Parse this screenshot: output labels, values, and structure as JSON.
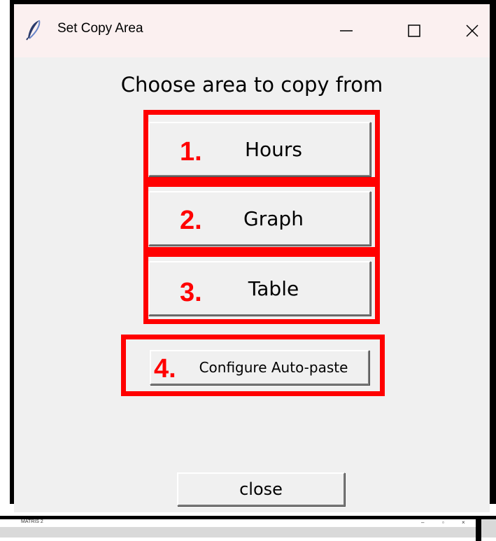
{
  "window": {
    "title": "Set Copy Area",
    "minimize_glyph": "—",
    "maximize_glyph": "☐",
    "close_glyph": "✕"
  },
  "main": {
    "heading": "Choose area to copy from",
    "buttons": [
      {
        "number": "1.",
        "label": "Hours"
      },
      {
        "number": "2.",
        "label": "Graph"
      },
      {
        "number": "3.",
        "label": "Table"
      },
      {
        "number": "4.",
        "label": "Configure Auto-paste"
      }
    ],
    "close_label": "close"
  },
  "background_window": {
    "title": "MATRIS 2",
    "minimize_glyph": "–",
    "maximize_glyph": "▫",
    "close_glyph": "×"
  },
  "colors": {
    "highlight": "#ff0000",
    "titlebar": "#fbf0f0",
    "window_bg": "#f0f0f0"
  },
  "icons": {
    "app_icon": "feather-icon"
  }
}
